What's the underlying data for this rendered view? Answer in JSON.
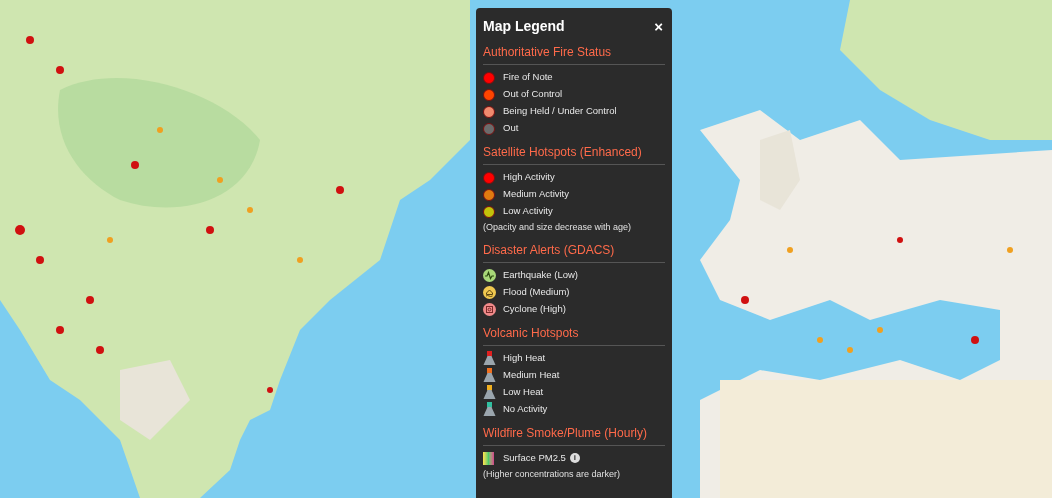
{
  "legend": {
    "title": "Map Legend",
    "close_label": "×",
    "sections": [
      {
        "title": "Authoritative Fire Status",
        "items": [
          {
            "kind": "dot",
            "label": "Fire of Note",
            "color": "#ff0000"
          },
          {
            "kind": "dot",
            "label": "Out of Control",
            "color": "#ff4500"
          },
          {
            "kind": "dot",
            "label": "Being Held / Under Control",
            "color": "#f08a6e"
          },
          {
            "kind": "dot",
            "label": "Out",
            "color": "#6b6b6b"
          }
        ]
      },
      {
        "title": "Satellite Hotspots (Enhanced)",
        "items": [
          {
            "kind": "dot",
            "label": "High Activity",
            "color": "#ff0000"
          },
          {
            "kind": "dot",
            "label": "Medium Activity",
            "color": "#e07a10"
          },
          {
            "kind": "dot",
            "label": "Low Activity",
            "color": "#c2c20a"
          }
        ],
        "note": "(Opacity and size decrease with age)"
      },
      {
        "title": "Disaster Alerts (GDACS)",
        "items": [
          {
            "kind": "earthquake",
            "label": "Earthquake (Low)",
            "color": "#a8d878"
          },
          {
            "kind": "flood",
            "label": "Flood (Medium)",
            "color": "#f0c850"
          },
          {
            "kind": "cyclone",
            "label": "Cyclone (High)",
            "color": "#f08a8a"
          }
        ]
      },
      {
        "title": "Volcanic Hotspots",
        "items": [
          {
            "kind": "volcano",
            "label": "High Heat",
            "color": "#e02020"
          },
          {
            "kind": "volcano",
            "label": "Medium Heat",
            "color": "#f07020"
          },
          {
            "kind": "volcano",
            "label": "Low Heat",
            "color": "#f0b020"
          },
          {
            "kind": "volcano",
            "label": "No Activity",
            "color": "#30c0a0"
          }
        ]
      },
      {
        "title": "Wildfire Smoke/Plume (Hourly)",
        "items": [
          {
            "kind": "gradient",
            "label": "Surface PM2.5",
            "info_label": "i"
          }
        ],
        "note": "(Higher concentrations are darker)"
      }
    ]
  }
}
